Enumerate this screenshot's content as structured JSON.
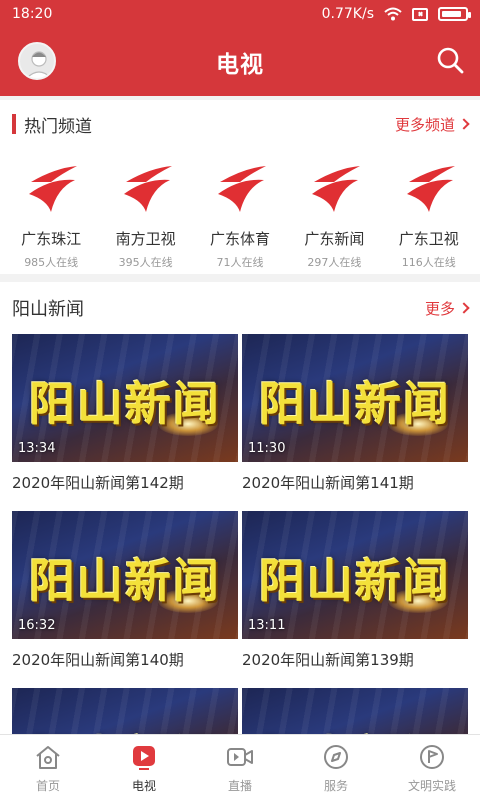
{
  "status": {
    "time": "18:20",
    "speed": "0.77K/s",
    "battery_level": 0.85
  },
  "header": {
    "title": "电视"
  },
  "hot_channels": {
    "title": "热门频道",
    "more_label": "更多频道",
    "items": [
      {
        "name": "广东珠江",
        "online": "985人在线"
      },
      {
        "name": "南方卫视",
        "online": "395人在线"
      },
      {
        "name": "广东体育",
        "online": "71人在线"
      },
      {
        "name": "广东新闻",
        "online": "297人在线"
      },
      {
        "name": "广东卫视",
        "online": "116人在线"
      }
    ]
  },
  "news": {
    "title": "阳山新闻",
    "more_label": "更多",
    "thumb_text": "阳山新闻",
    "cards": [
      {
        "duration": "13:34",
        "title": "2020年阳山新闻第142期"
      },
      {
        "duration": "11:30",
        "title": "2020年阳山新闻第141期"
      },
      {
        "duration": "16:32",
        "title": "2020年阳山新闻第140期"
      },
      {
        "duration": "13:11",
        "title": "2020年阳山新闻第139期"
      },
      {
        "duration": "",
        "title": ""
      },
      {
        "duration": "",
        "title": ""
      }
    ]
  },
  "tabs": [
    {
      "label": "首页",
      "icon": "home-icon"
    },
    {
      "label": "电视",
      "icon": "tv-play-icon"
    },
    {
      "label": "直播",
      "icon": "video-camera-icon"
    },
    {
      "label": "服务",
      "icon": "compass-icon"
    },
    {
      "label": "文明实践",
      "icon": "flag-icon"
    }
  ],
  "colors": {
    "brand_red": "#d5373b",
    "link_red": "#e03a3e"
  }
}
